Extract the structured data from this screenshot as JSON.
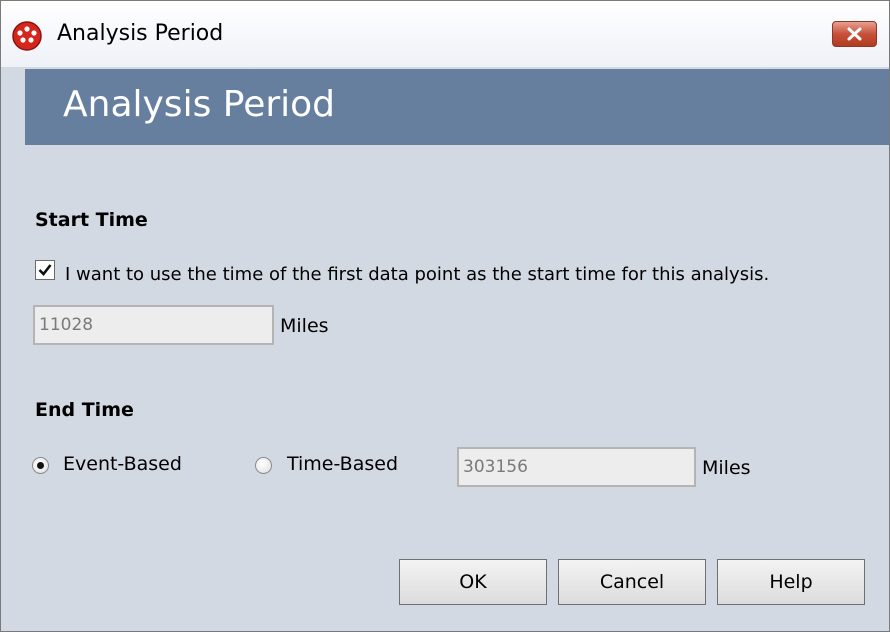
{
  "window": {
    "title": "Analysis Period",
    "app_icon": "meridium-logo-icon",
    "close_icon": "close-icon"
  },
  "header": {
    "title": "Analysis Period"
  },
  "start_time": {
    "label": "Start Time",
    "use_first_point_checked": true,
    "use_first_point_label": "I want to use the time of the first data point as the start time for this analysis.",
    "value": "11028",
    "unit": "Miles"
  },
  "end_time": {
    "label": "End Time",
    "options": [
      {
        "label": "Event-Based",
        "selected": true
      },
      {
        "label": "Time-Based",
        "selected": false
      }
    ],
    "value": "303156",
    "unit": "Miles"
  },
  "buttons": {
    "ok": "OK",
    "cancel": "Cancel",
    "help": "Help"
  },
  "colors": {
    "header_bg": "#677f9f",
    "panel_bg": "#d3d9e3",
    "close_button": "#c7513a"
  }
}
